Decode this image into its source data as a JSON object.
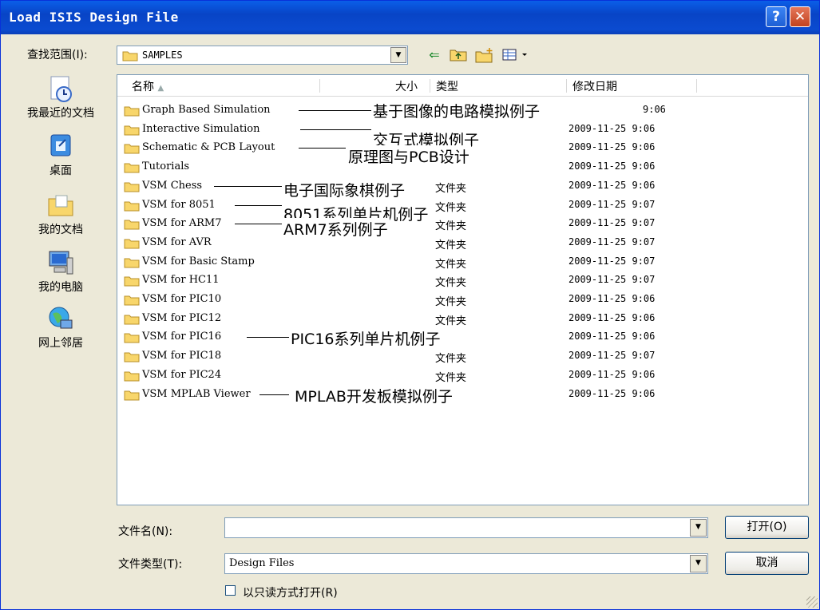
{
  "window": {
    "title": "Load ISIS Design File",
    "help_label": "?",
    "close_label": "✕"
  },
  "lookin": {
    "label": "查找范围(I):",
    "value": "SAMPLES"
  },
  "places": [
    {
      "label": "我最近的文档",
      "icon": "recent-documents-icon"
    },
    {
      "label": "桌面",
      "icon": "desktop-icon"
    },
    {
      "label": "我的文档",
      "icon": "my-documents-icon"
    },
    {
      "label": "我的电脑",
      "icon": "my-computer-icon"
    },
    {
      "label": "网上邻居",
      "icon": "network-places-icon"
    }
  ],
  "columns": {
    "name": "名称",
    "size": "大小",
    "type": "类型",
    "modified": "修改日期"
  },
  "files": [
    {
      "name": "Graph Based Simulation",
      "type": "",
      "date": "9:06"
    },
    {
      "name": "Interactive Simulation",
      "type": "",
      "date": "2009-11-25 9:06"
    },
    {
      "name": "Schematic & PCB Layout",
      "type": "",
      "date": "2009-11-25 9:06"
    },
    {
      "name": "Tutorials",
      "type": "",
      "date": "2009-11-25 9:06"
    },
    {
      "name": "VSM Chess",
      "type": "文件夹",
      "date": "2009-11-25 9:06"
    },
    {
      "name": "VSM for 8051",
      "type": "文件夹",
      "date": "2009-11-25 9:07"
    },
    {
      "name": "VSM for ARM7",
      "type": "文件夹",
      "date": "2009-11-25 9:07"
    },
    {
      "name": "VSM for AVR",
      "type": "文件夹",
      "date": "2009-11-25 9:07"
    },
    {
      "name": "VSM for Basic Stamp",
      "type": "文件夹",
      "date": "2009-11-25 9:07"
    },
    {
      "name": "VSM for HC11",
      "type": "文件夹",
      "date": "2009-11-25 9:07"
    },
    {
      "name": "VSM for PIC10",
      "type": "文件夹",
      "date": "2009-11-25 9:06"
    },
    {
      "name": "VSM for PIC12",
      "type": "文件夹",
      "date": "2009-11-25 9:06"
    },
    {
      "name": "VSM for PIC16",
      "type": "",
      "date": "2009-11-25 9:06"
    },
    {
      "name": "VSM for PIC18",
      "type": "文件夹",
      "date": "2009-11-25 9:07"
    },
    {
      "name": "VSM for PIC24",
      "type": "文件夹",
      "date": "2009-11-25 9:06"
    },
    {
      "name": "VSM MPLAB Viewer",
      "type": "",
      "date": "2009-11-25 9:06"
    }
  ],
  "annotations": [
    {
      "text": "基于图像的电路模拟例子"
    },
    {
      "text": "交互式模拟例子"
    },
    {
      "text": "原理图与PCB设计"
    },
    {
      "text": "电子国际象棋例子"
    },
    {
      "text": "8051系列单片机例子"
    },
    {
      "text": "ARM7系列例子"
    },
    {
      "text": "PIC16系列单片机例子"
    },
    {
      "text": "MPLAB开发板模拟例子"
    }
  ],
  "filename": {
    "label": "文件名(N):",
    "value": ""
  },
  "filetype": {
    "label": "文件类型(T):",
    "value": "Design Files"
  },
  "readonly": {
    "label": "以只读方式打开(R)",
    "checked": false
  },
  "buttons": {
    "open": "打开(O)",
    "cancel": "取消"
  }
}
